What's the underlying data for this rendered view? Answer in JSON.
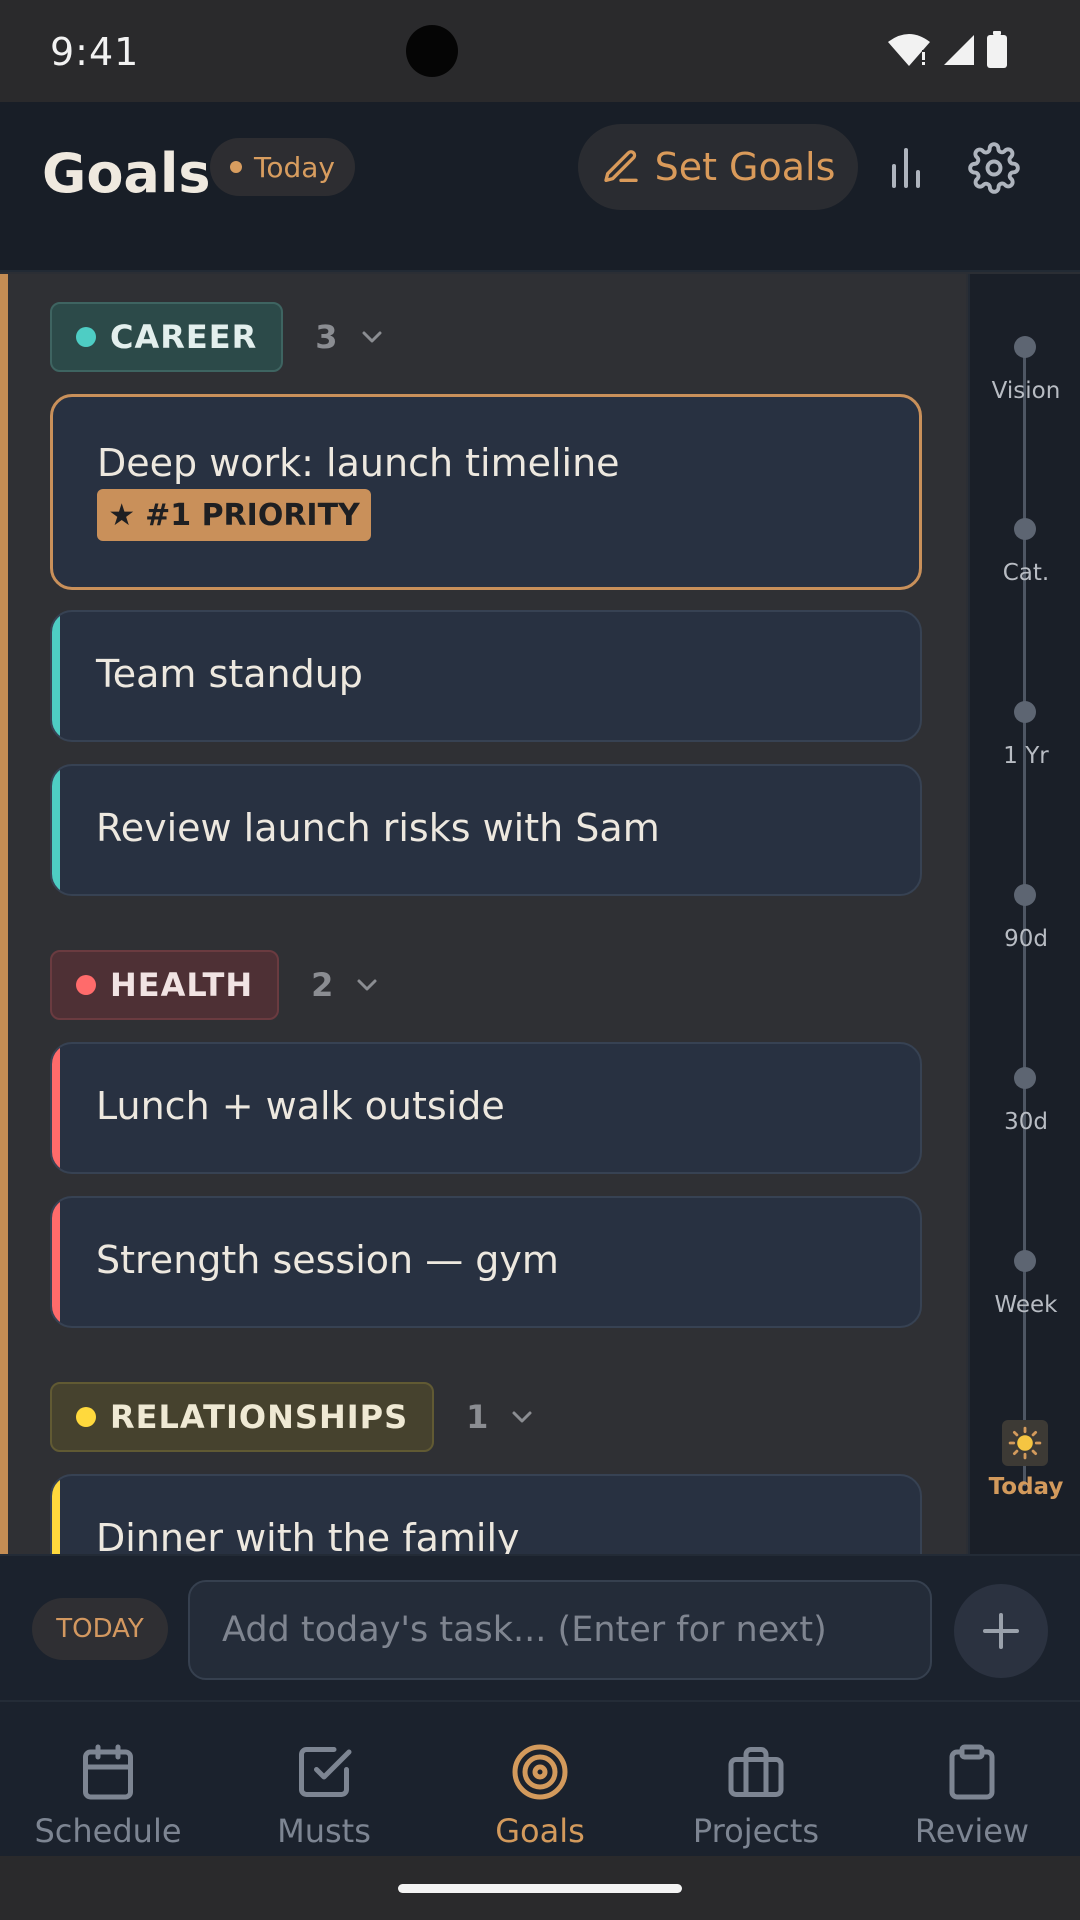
{
  "status_bar": {
    "time": "9:41"
  },
  "header": {
    "title": "Goals",
    "scope_pill": "Today",
    "set_goals_label": "Set Goals"
  },
  "sections": [
    {
      "category": "CAREER",
      "count": "3",
      "color": "#4ecdc4",
      "tasks": [
        {
          "title": "Deep work: launch timeline",
          "badge": "#1 PRIORITY"
        },
        {
          "title": "Team standup"
        },
        {
          "title": "Review launch risks with Sam"
        }
      ]
    },
    {
      "category": "HEALTH",
      "count": "2",
      "color": "#ff6b6b",
      "tasks": [
        {
          "title": "Lunch + walk outside"
        },
        {
          "title": "Strength session — gym"
        }
      ]
    },
    {
      "category": "RELATIONSHIPS",
      "count": "1",
      "color": "#ffd93d",
      "tasks": [
        {
          "title": "Dinner with the family"
        }
      ]
    }
  ],
  "timeline": {
    "levels": [
      "Vision",
      "Cat.",
      "1 Yr",
      "90d",
      "30d",
      "Week",
      "Today"
    ],
    "active": "Today"
  },
  "composer": {
    "chip": "TODAY",
    "placeholder": "Add today's task... (Enter for next)"
  },
  "nav": {
    "items": [
      {
        "label": "Schedule",
        "icon": "calendar-icon"
      },
      {
        "label": "Musts",
        "icon": "checkbox-icon"
      },
      {
        "label": "Goals",
        "icon": "target-icon"
      },
      {
        "label": "Projects",
        "icon": "briefcase-icon"
      },
      {
        "label": "Review",
        "icon": "clipboard-icon"
      }
    ],
    "active": "Goals"
  },
  "colors": {
    "accent": "#d39a5c",
    "background": "#2f3034",
    "card": "#283141"
  }
}
